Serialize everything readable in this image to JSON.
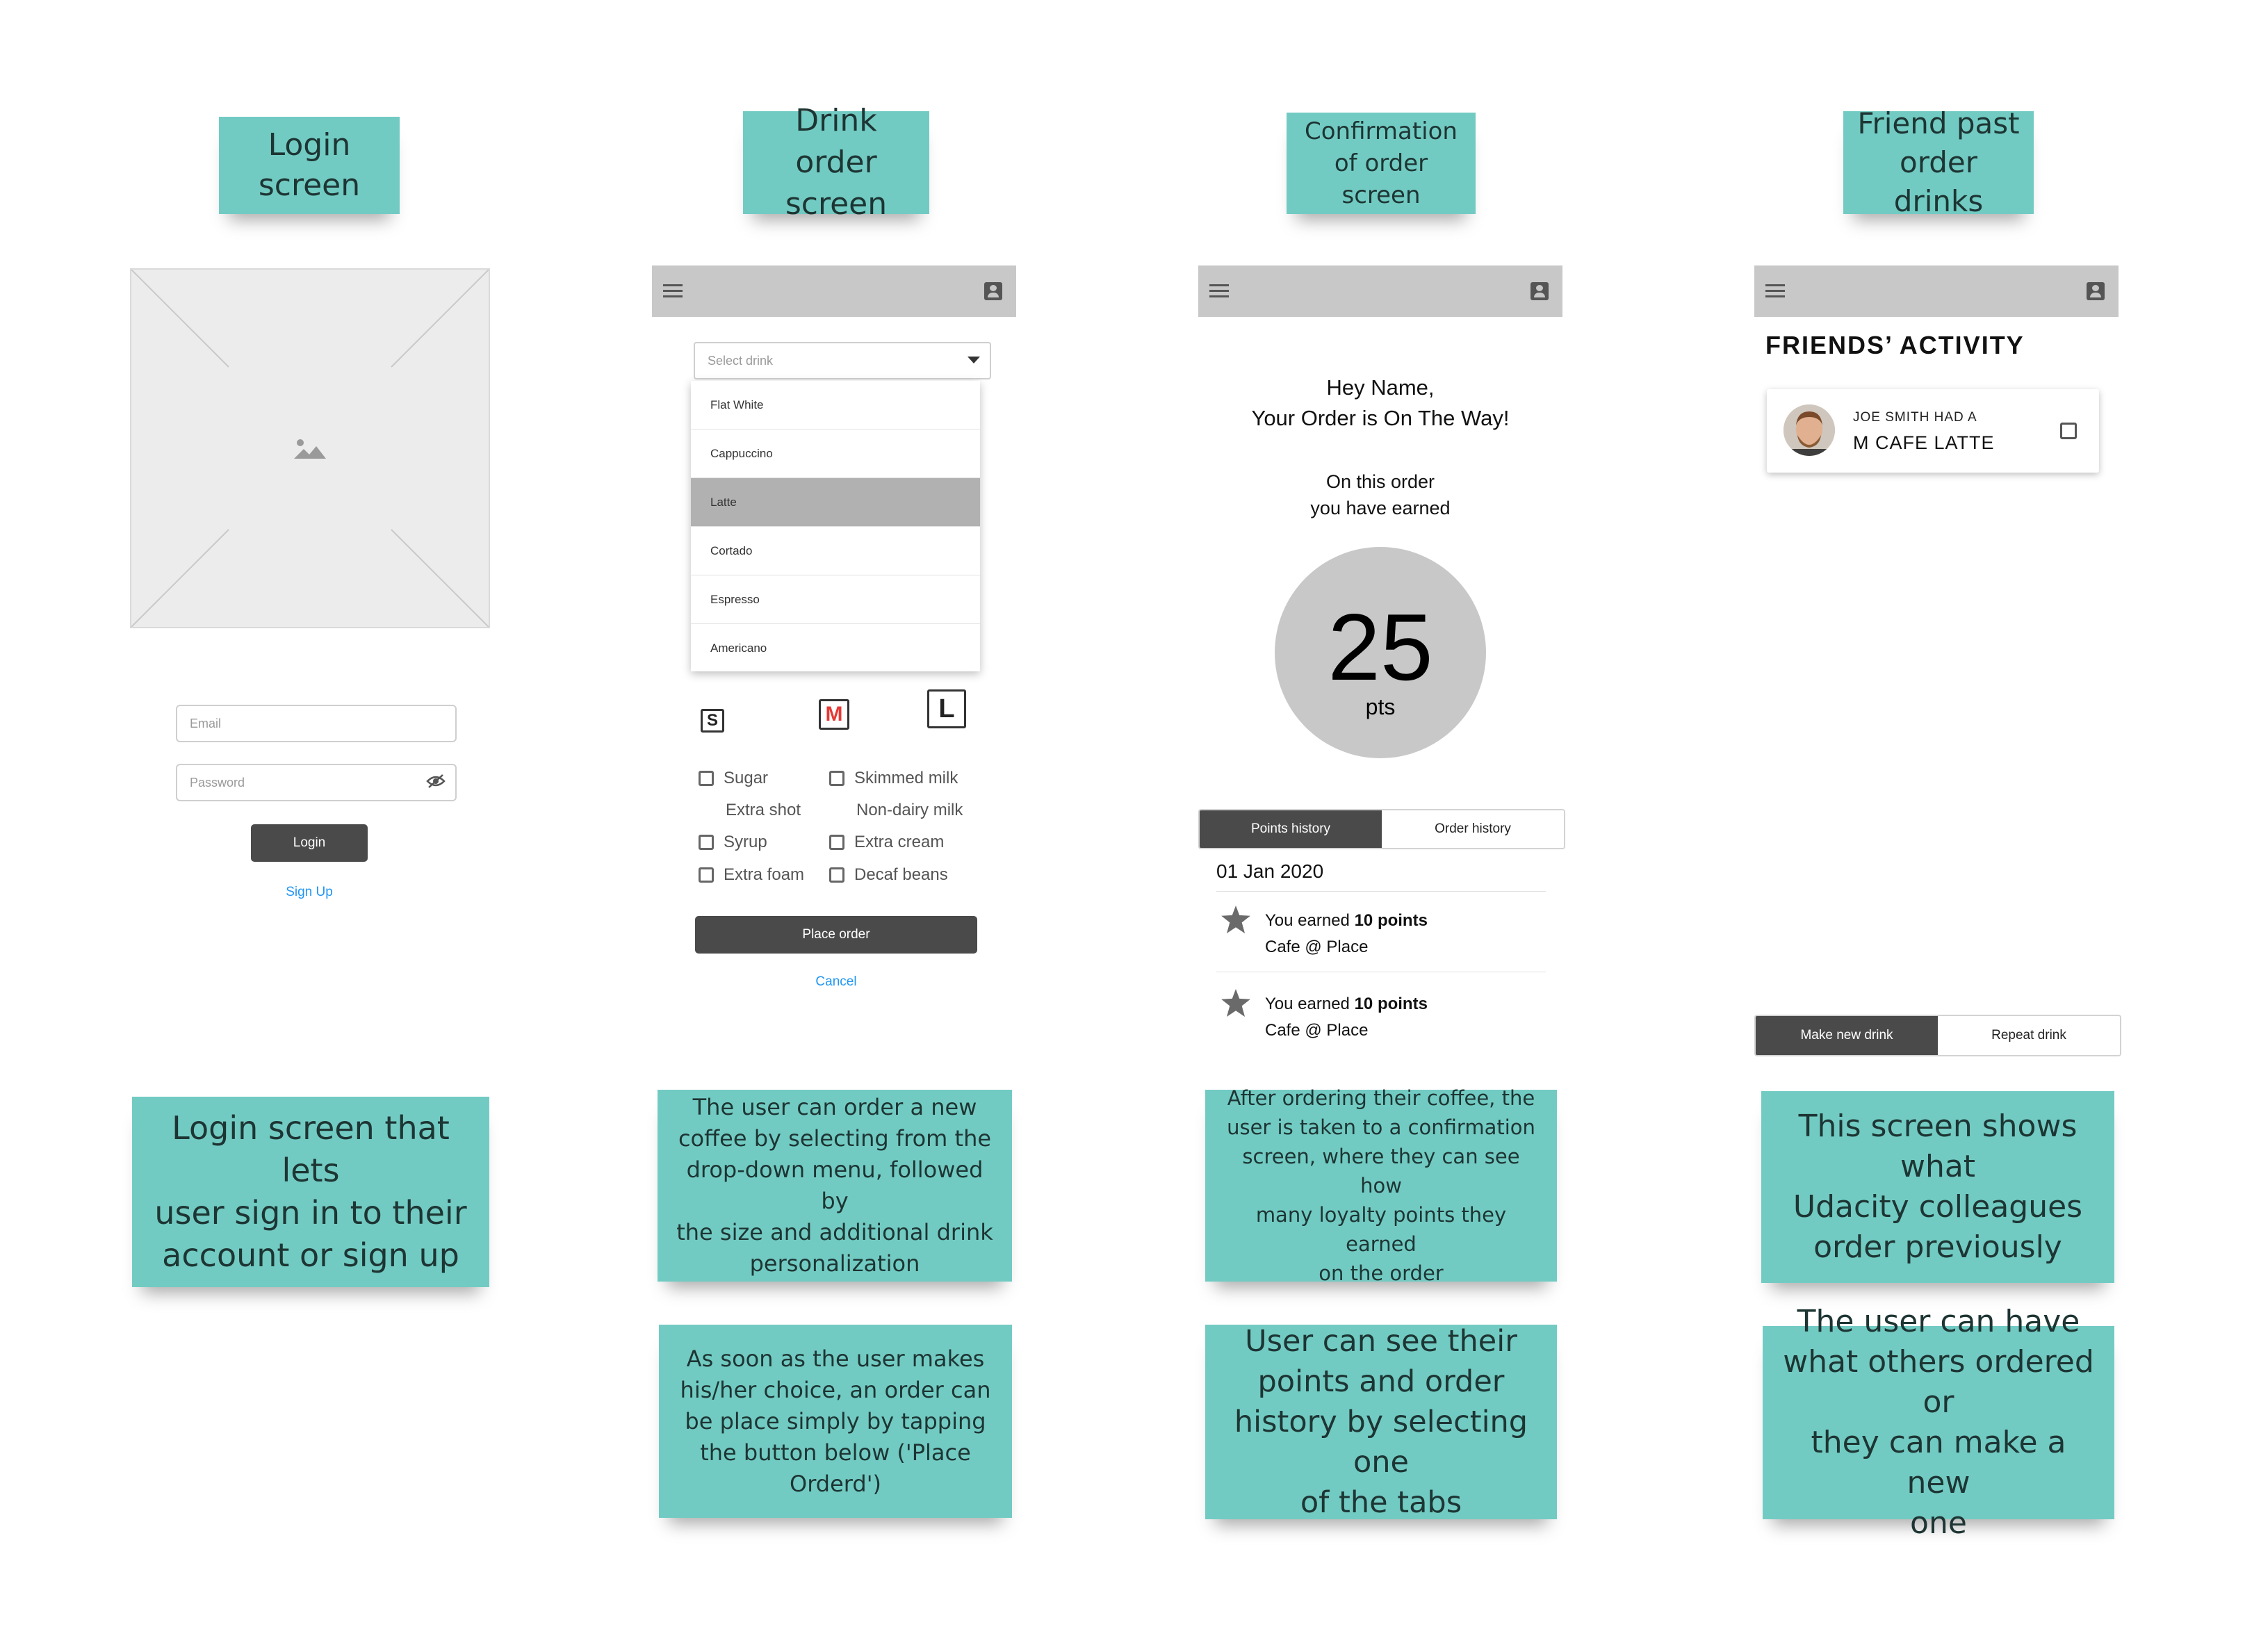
{
  "stickies": {
    "login_title": [
      "Login",
      "screen"
    ],
    "drink_title": [
      "Drink order",
      "screen"
    ],
    "confirm_title": [
      "Confirmation",
      "of order screen"
    ],
    "friend_title": [
      "Friend past",
      "order drinks"
    ],
    "login_desc": [
      "Login screen that lets",
      "user sign in to their",
      "account or sign up"
    ],
    "drink_desc": [
      "The user can order a new",
      "coffee by selecting from the",
      "drop-down menu, followed by",
      "the size and additional drink",
      "personalization"
    ],
    "drink_desc2": [
      "As soon as the user makes",
      "his/her choice, an order can",
      "be place simply by tapping",
      "the button below ('Place",
      "Orderd')"
    ],
    "confirm_desc": [
      "After ordering their coffee, the",
      "user is taken to a confirmation",
      "screen, where they can see how",
      "many loyalty points they earned",
      "on the order"
    ],
    "confirm_desc2": [
      "User can see their",
      "points and order",
      "history by selecting one",
      "of the tabs"
    ],
    "friend_desc": [
      "This screen shows what",
      "Udacity colleagues",
      "order previously"
    ],
    "friend_desc2": [
      "The user can have",
      "what others ordered or",
      "they can make a new",
      "one"
    ]
  },
  "login": {
    "image_icon": "image-icon",
    "email_placeholder": "Email",
    "password_placeholder": "Password",
    "login_button": "Login",
    "signup_link": "Sign Up"
  },
  "drink": {
    "select_placeholder": "Select drink",
    "options": [
      "Flat White",
      "Cappuccino",
      "Latte",
      "Cortado",
      "Espresso",
      "Americano"
    ],
    "selected_option": "Latte",
    "sizes": [
      "S",
      "M",
      "L"
    ],
    "selected_size": "M",
    "extras_left": [
      "Sugar",
      "Extra shot",
      "Syrup",
      "Extra foam"
    ],
    "extras_right": [
      "Skimmed milk",
      "Non-dairy milk",
      "Extra cream",
      "Decaf beans"
    ],
    "place_order": "Place order",
    "cancel": "Cancel"
  },
  "confirm": {
    "greeting": "Hey Name,",
    "status": "Your Order is On The Way!",
    "earned_line1": "On this order",
    "earned_line2": "you have earned",
    "points": "25",
    "points_unit": "pts",
    "tab_points": "Points history",
    "tab_orders": "Order history",
    "date": "01 Jan 2020",
    "history": [
      {
        "prefix": "You earned ",
        "bold": "10 points",
        "place": "Cafe @ Place"
      },
      {
        "prefix": "You earned ",
        "bold": "10 points",
        "place": "Cafe @ Place"
      }
    ]
  },
  "friends": {
    "heading": "FRIENDS’ ACTIVITY",
    "card_line1": "JOE SMITH HAD A",
    "card_line2": "M CAFE LATTE",
    "btn_new": "Make new drink",
    "btn_repeat": "Repeat drink"
  },
  "colors": {
    "sticky": "#72cbc3",
    "appbar": "#c8c8c8",
    "dark_button": "#4a4a4a",
    "link": "#2196f3",
    "size_selected": "#e53935"
  }
}
